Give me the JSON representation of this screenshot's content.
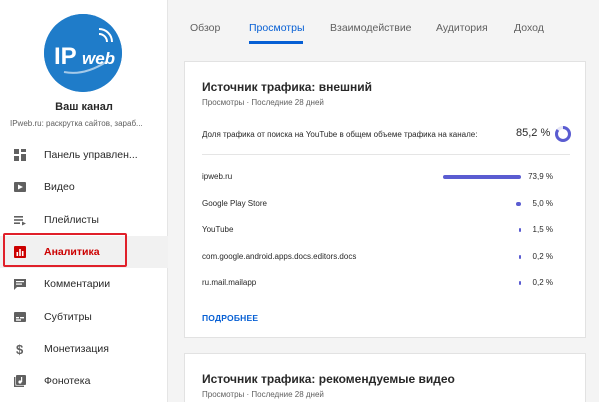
{
  "sidebar": {
    "logo_text": "IPweb",
    "channel_name": "Ваш канал",
    "channel_desc": "IPweb.ru: раскрутка сайтов, зараб...",
    "items": [
      {
        "label": "Панель управлен...",
        "icon": "dashboard-icon",
        "active": false
      },
      {
        "label": "Видео",
        "icon": "video-icon",
        "active": false
      },
      {
        "label": "Плейлисты",
        "icon": "playlist-icon",
        "active": false
      },
      {
        "label": "Аналитика",
        "icon": "analytics-icon",
        "active": true
      },
      {
        "label": "Комментарии",
        "icon": "comments-icon",
        "active": false
      },
      {
        "label": "Субтитры",
        "icon": "subtitles-icon",
        "active": false
      },
      {
        "label": "Монетизация",
        "icon": "dollar-icon",
        "active": false
      },
      {
        "label": "Фонотека",
        "icon": "music-library-icon",
        "active": false
      }
    ]
  },
  "tabs": [
    {
      "label": "Обзор",
      "active": false
    },
    {
      "label": "Просмотры",
      "active": true
    },
    {
      "label": "Взаимодействие",
      "active": false
    },
    {
      "label": "Аудитория",
      "active": false
    },
    {
      "label": "Доход",
      "active": false
    }
  ],
  "card1": {
    "title": "Источник трафика: внешний",
    "subtitle": "Просмотры · Последние 28 дней",
    "share_text": "Доля трафика от поиска на YouTube в общем объеме трафика на канале:",
    "share_value": "85,2 %",
    "share_fraction": 0.852,
    "rows": [
      {
        "label": "ipweb.ru",
        "pct": "73,9 %",
        "value": 73.9
      },
      {
        "label": "Google Play Store",
        "pct": "5,0 %",
        "value": 5.0
      },
      {
        "label": "YouTube",
        "pct": "1,5 %",
        "value": 1.5
      },
      {
        "label": "com.google.android.apps.docs.editors.docs",
        "pct": "0,2 %",
        "value": 0.2
      },
      {
        "label": "ru.mail.mailapp",
        "pct": "0,2 %",
        "value": 0.2
      }
    ],
    "more_label": "ПОДРОБНЕЕ"
  },
  "card2": {
    "title": "Источник трафика: рекомендуемые видео",
    "subtitle": "Просмотры · Последние 28 дней"
  },
  "colors": {
    "accent": "#065fd4",
    "bar": "#5a5cd1",
    "active_nav": "#cc0000",
    "highlight_border": "#e0202a",
    "logo_bg": "#1f7cc9"
  }
}
